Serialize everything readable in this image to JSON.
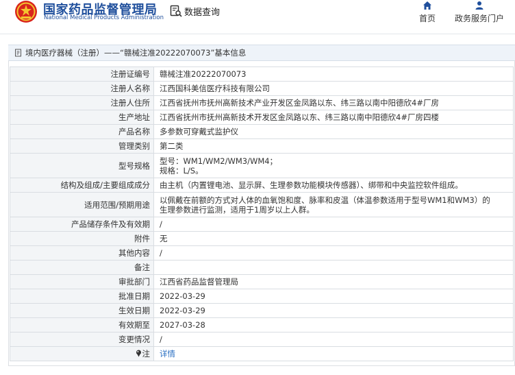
{
  "header": {
    "site_name_cn": "国家药品监督管理局",
    "site_name_en": "National Medical Products Administration",
    "query_label": "数据查询",
    "nav": [
      {
        "label": "首页",
        "icon": "home-icon"
      },
      {
        "label": "政务服务门户",
        "icon": "user-icon"
      }
    ]
  },
  "breadcrumb": {
    "text": "境内医疗器械（注册）——“赣械注准20222070073”基本信息"
  },
  "details": {
    "rows": [
      {
        "label": "注册证编号",
        "value": "赣械注准20222070073"
      },
      {
        "label": "注册人名称",
        "value": "江西国科美信医疗科技有限公司"
      },
      {
        "label": "注册人住所",
        "value": "江西省抚州市抚州高新技术产业开发区金凤路以东、纬三路以南中阳德欣4#厂房"
      },
      {
        "label": "生产地址",
        "value": "江西省抚州市抚州高新技术开发区金凤路以东、纬三路以南中阳德欣4#厂房四楼"
      },
      {
        "label": "产品名称",
        "value": "多参数可穿戴式监护仪"
      },
      {
        "label": "管理类别",
        "value": "第二类"
      },
      {
        "label": "型号规格",
        "value_lines": [
          "型号：WM1/WM2/WM3/WM4；",
          "规格：L/S。"
        ]
      },
      {
        "label": "结构及组成/主要组成成分",
        "value": "由主机（内置锂电池、显示屏、生理参数功能模块传感器）、绑带和中央监控软件组成。"
      },
      {
        "label": "适用范围/预期用途",
        "value_lines": [
          "以佩戴在前额的方式对人体的血氧饱和度、脉率和皮温（体温参数适用于型号WM1和WM3）的",
          "生理参数进行监测，适用于1周岁以上人群。"
        ]
      },
      {
        "label": "产品储存条件及有效期",
        "value": "/"
      },
      {
        "label": "附件",
        "value": "无"
      },
      {
        "label": "其他内容",
        "value": "/"
      },
      {
        "label": "备注",
        "value": ""
      },
      {
        "label": "审批部门",
        "value": "江西省药品监督管理局"
      },
      {
        "label": "批准日期",
        "value": "2022-03-29"
      },
      {
        "label": "生效日期",
        "value": "2022-03-29"
      },
      {
        "label": "有效期至",
        "value": "2027-03-28"
      },
      {
        "label": "变更情况",
        "value": "/"
      },
      {
        "label": "注",
        "value": "详情",
        "icon": "pin-icon"
      }
    ]
  },
  "colors": {
    "brand": "#1f4f9c",
    "label_bg": "#f3f5f7",
    "title_bar_bg": "#eef3f9",
    "link": "#2a6fc2"
  }
}
